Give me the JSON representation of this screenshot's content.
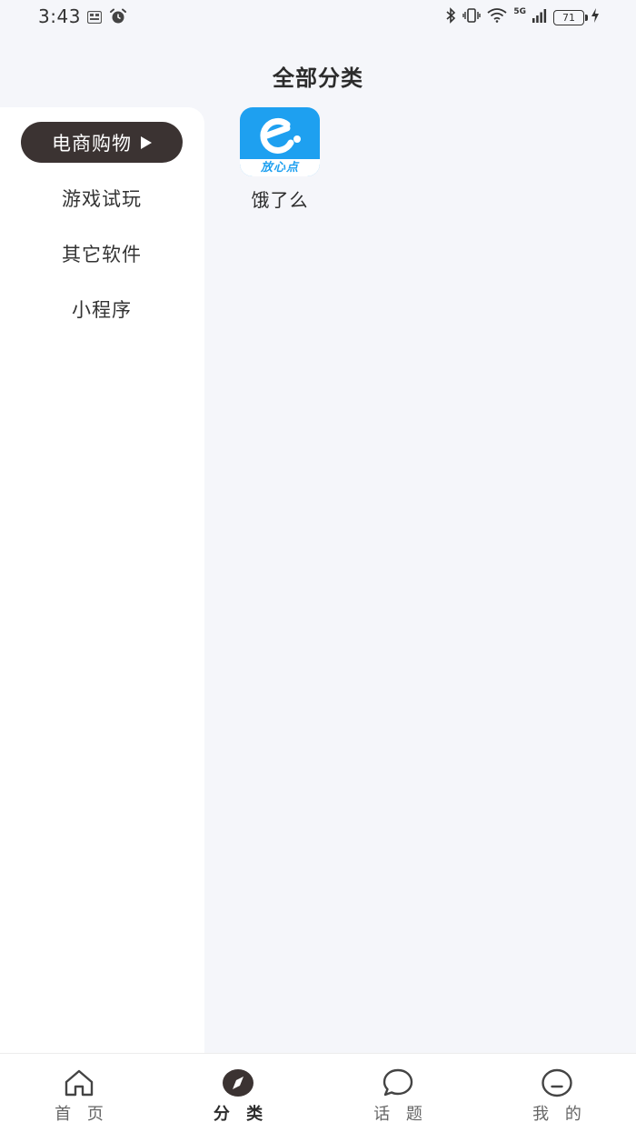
{
  "status_bar": {
    "time": "3:43",
    "network": "5G",
    "battery": "71"
  },
  "header": {
    "title": "全部分类"
  },
  "sidebar": {
    "items": [
      {
        "label": "电商购物",
        "active": true
      },
      {
        "label": "游戏试玩",
        "active": false
      },
      {
        "label": "其它软件",
        "active": false
      },
      {
        "label": "小程序",
        "active": false
      }
    ]
  },
  "content": {
    "apps": [
      {
        "name": "饿了么",
        "icon_caption": "放心点",
        "icon_color": "#1ea0f0"
      }
    ]
  },
  "bottom_nav": {
    "items": [
      {
        "label": "首 页",
        "icon": "home-icon",
        "active": false
      },
      {
        "label": "分 类",
        "icon": "compass-icon",
        "active": true
      },
      {
        "label": "话 题",
        "icon": "chat-bubble-icon",
        "active": false
      },
      {
        "label": "我 的",
        "icon": "profile-icon",
        "active": false
      }
    ]
  },
  "colors": {
    "accent_dark": "#3b3332",
    "page_bg": "#f5f6fa",
    "app_blue": "#1ea0f0"
  }
}
